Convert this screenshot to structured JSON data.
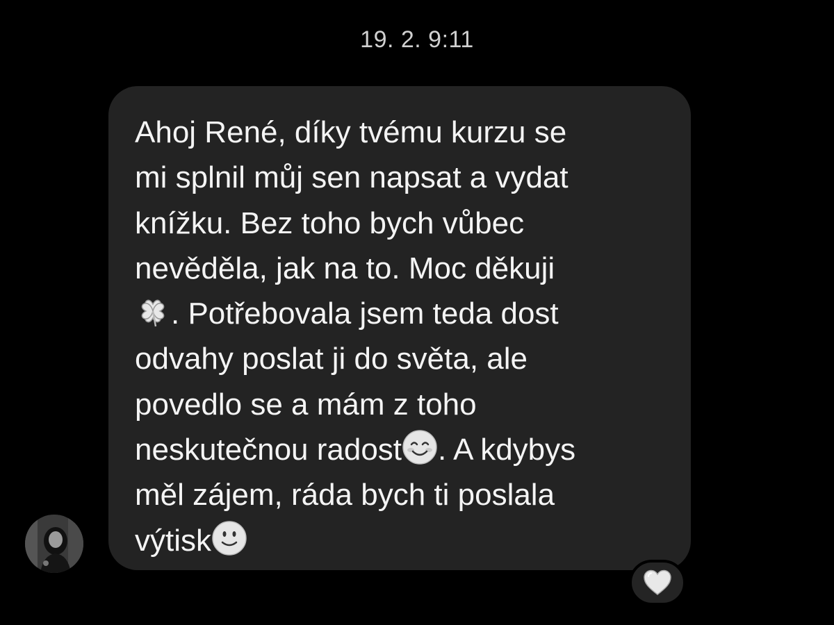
{
  "conversation": {
    "timestamp": "19. 2. 9:11"
  },
  "message": {
    "lines": [
      "Ahoj René, díky tvému kurzu se",
      "mi splnil můj sen napsat a vydat",
      "knížku. Bez toho bych vůbec",
      "nevěděla, jak na to. Moc děkuji",
      ". Potřebovala jsem teda dost",
      "odvahy poslat ji do světa, ale",
      "povedlo se a mám z toho",
      "neskutečnou radost",
      ". A kdybys",
      "měl zájem, ráda bych ti poslala",
      "výtisk"
    ],
    "emojis": [
      "four-leaf-clover-icon",
      "smiling-face-icon",
      "slightly-smiling-face-icon"
    ]
  },
  "sender": {
    "avatar_icon": "avatar"
  },
  "reaction": {
    "icon": "white-heart-icon"
  },
  "colors": {
    "background": "#000000",
    "bubble": "#232323",
    "text": "#f4f4f4",
    "timestamp": "#d0d0d0"
  }
}
